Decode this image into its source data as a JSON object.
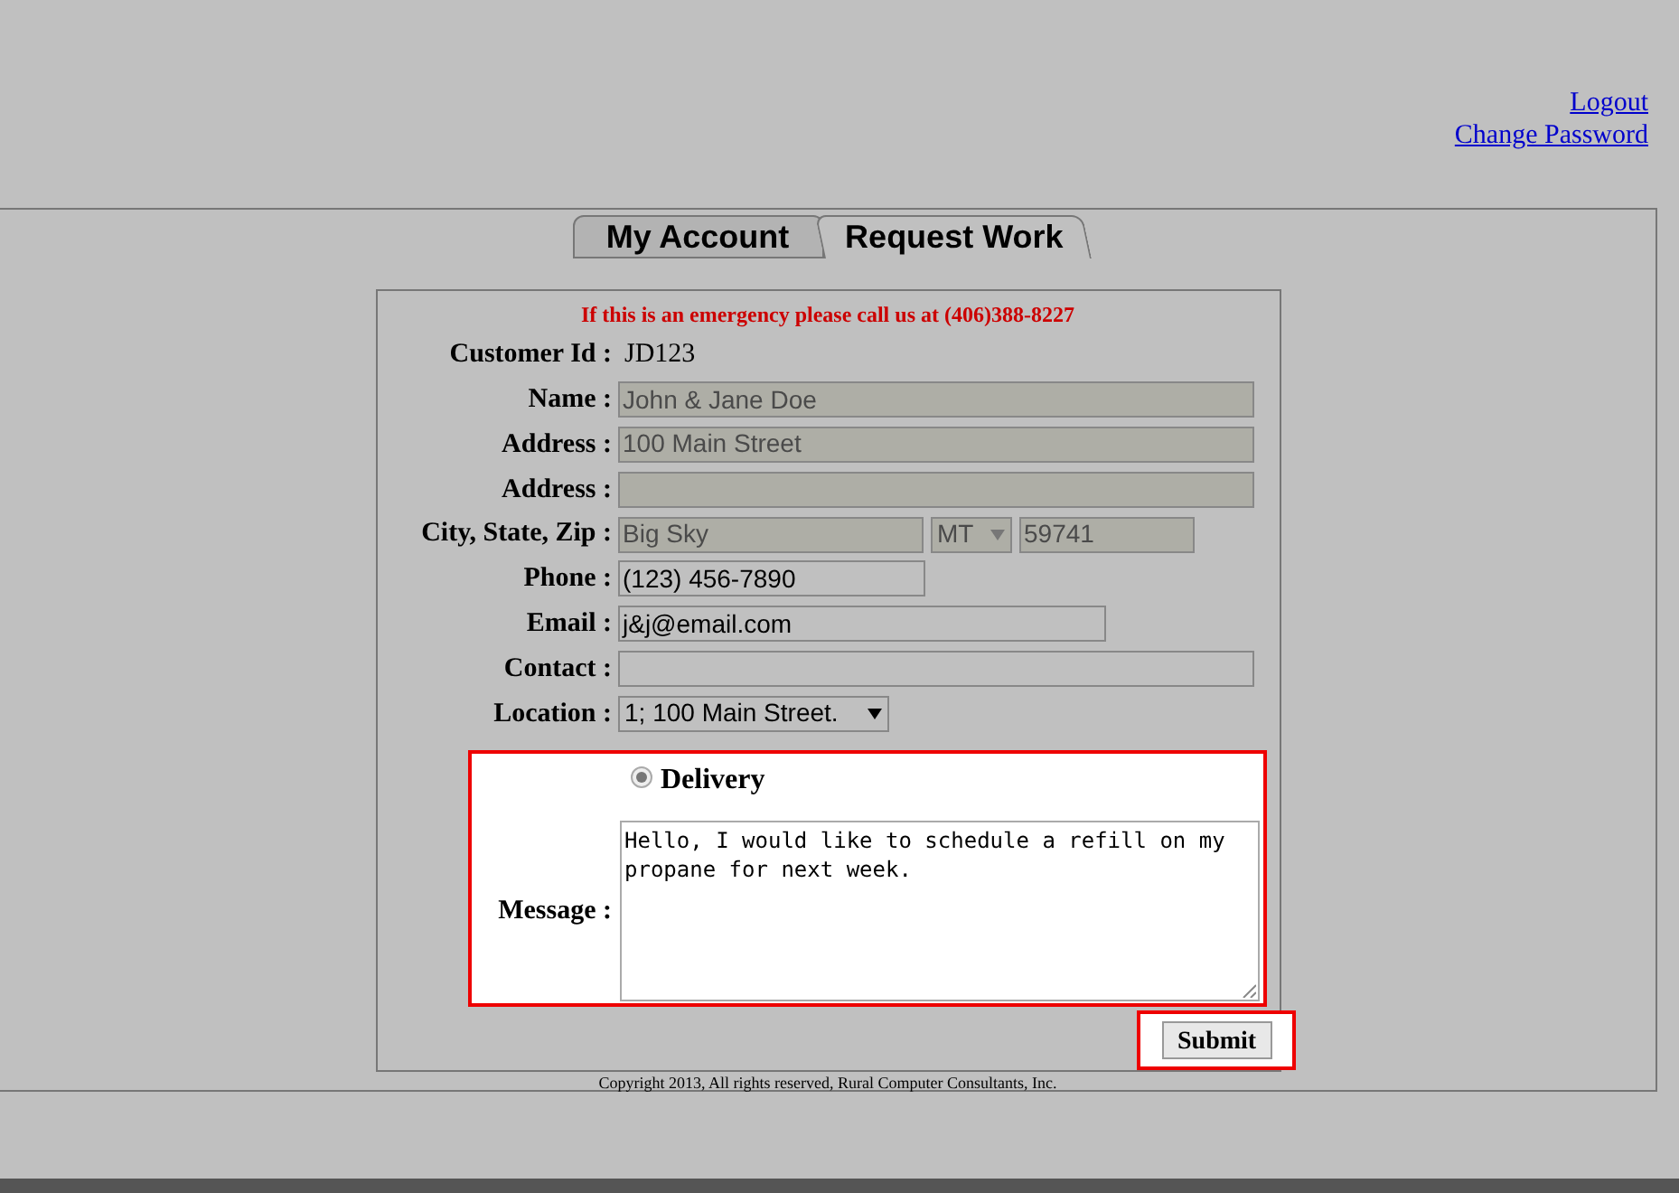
{
  "top_links": [
    {
      "label": "Logout"
    },
    {
      "label": "Change Password"
    }
  ],
  "tabs": [
    {
      "label": "My Account",
      "selected": false
    },
    {
      "label": "Request Work",
      "selected": true
    }
  ],
  "notice": "If this is an emergency please call us at (406)388-8227",
  "customer_id": {
    "label": "Customer Id :",
    "value": "JD123"
  },
  "fields": [
    {
      "label": "Name :",
      "inputs": [
        {
          "kind": "text",
          "value": "John & Jane Doe",
          "disabled": true
        }
      ]
    },
    {
      "label": "Address :",
      "inputs": [
        {
          "kind": "text",
          "value": "100 Main Street",
          "disabled": true
        }
      ]
    },
    {
      "label": "Address :",
      "inputs": [
        {
          "kind": "text",
          "disabled": true
        }
      ]
    },
    {
      "label": "City, State, Zip :",
      "inputs": [
        {
          "kind": "text",
          "value": "Big Sky",
          "disabled": true
        },
        {
          "kind": "select",
          "value": "MT",
          "disabled": true
        },
        {
          "kind": "text",
          "value": "59741",
          "disabled": true
        }
      ]
    },
    {
      "label": "Phone :",
      "inputs": [
        {
          "kind": "text",
          "value": "(123) 456-7890",
          "disabled": false
        }
      ]
    },
    {
      "label": "Email :",
      "inputs": [
        {
          "kind": "text",
          "value": "j&j@email.com",
          "disabled": false
        }
      ]
    },
    {
      "label": "Contact :",
      "inputs": [
        {
          "kind": "text",
          "disabled": false
        }
      ]
    },
    {
      "label": "Location :",
      "inputs": [
        {
          "kind": "select",
          "value": "1; 100 Main Street.",
          "disabled": false
        }
      ]
    }
  ],
  "request_type": {
    "label": "Delivery",
    "selected": true
  },
  "message": {
    "label": "Message :",
    "value": "Hello, I would like to schedule a refill on my propane for next week."
  },
  "submit": "Submit",
  "copyright": "Copyright 2013, All rights reserved, Rural Computer Consultants, Inc."
}
